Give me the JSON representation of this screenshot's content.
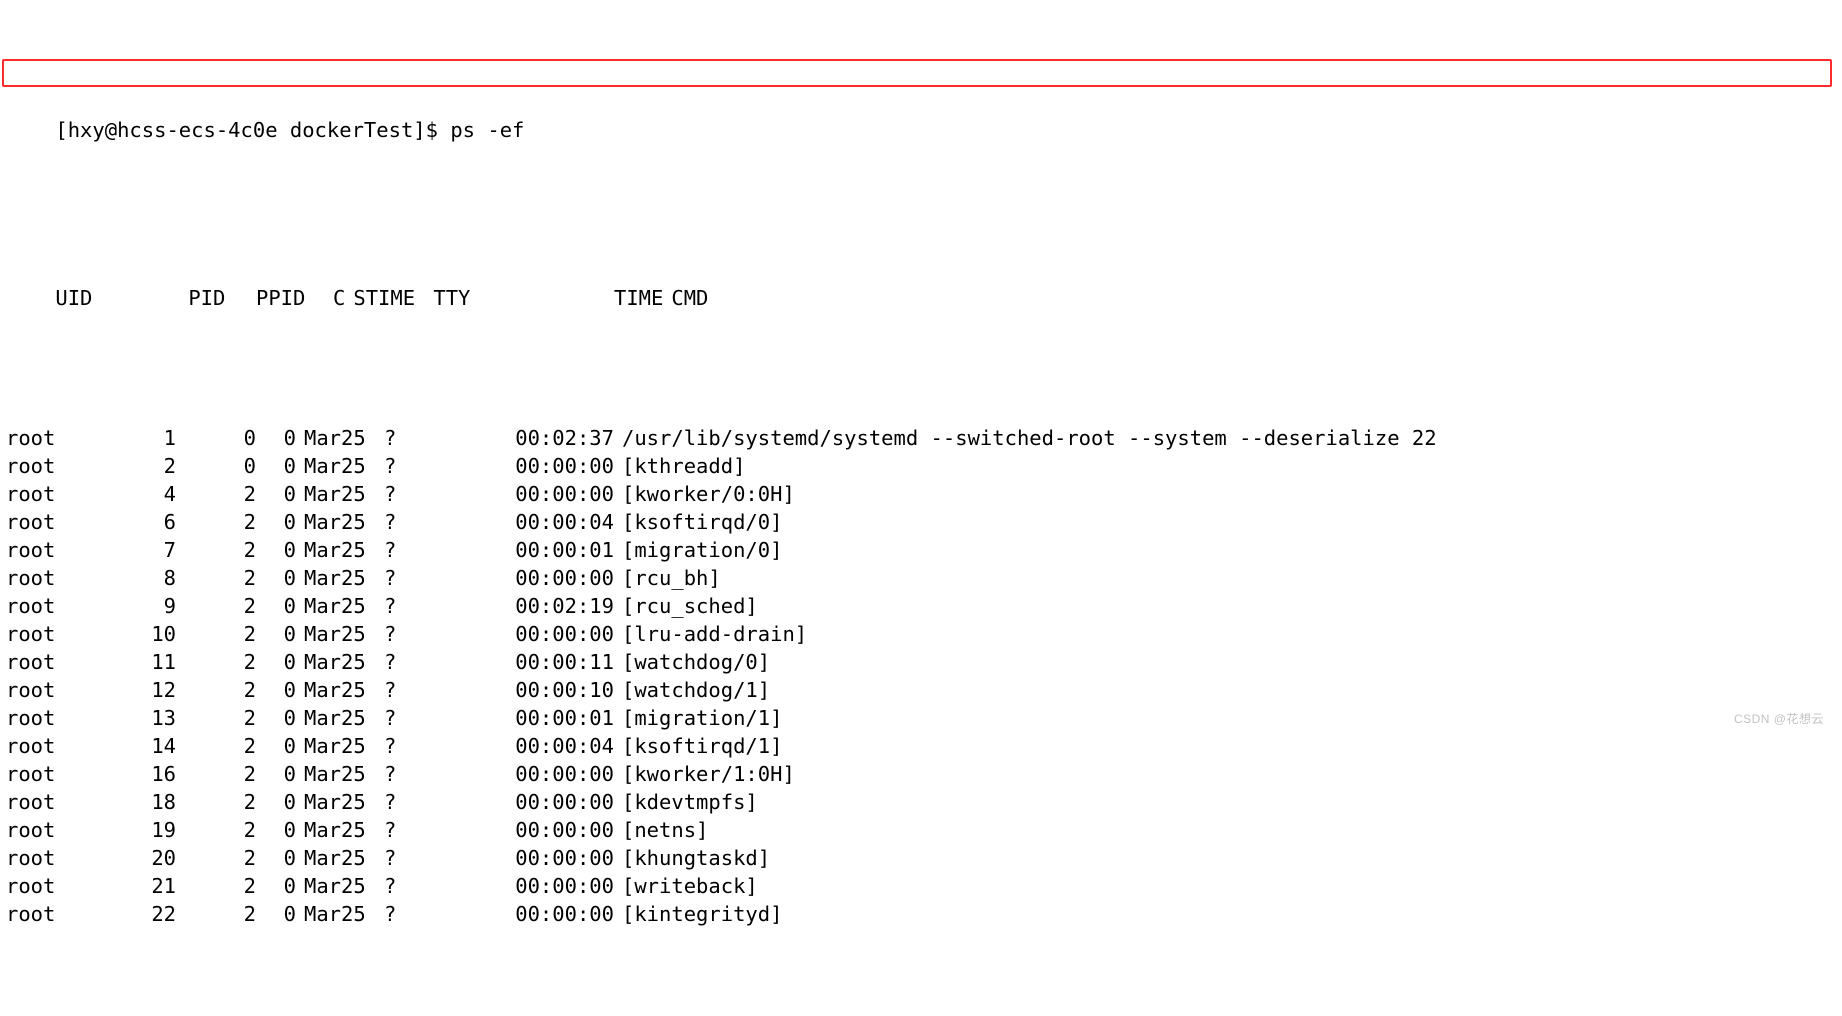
{
  "prompt_line": "[hxy@hcss-ecs-4c0e dockerTest]$ ps -ef",
  "headers": {
    "uid": "UID",
    "pid": "PID",
    "ppid": "PPID",
    "c": "C",
    "stime": "STIME",
    "tty": "TTY",
    "time": "TIME",
    "cmd": "CMD"
  },
  "rows": [
    {
      "uid": "root",
      "pid": "1",
      "ppid": "0",
      "c": "0",
      "stime": "Mar25",
      "tty": "?",
      "time": "00:02:37",
      "cmd": "/usr/lib/systemd/systemd --switched-root --system --deserialize 22",
      "hl": true
    },
    {
      "uid": "root",
      "pid": "2",
      "ppid": "0",
      "c": "0",
      "stime": "Mar25",
      "tty": "?",
      "time": "00:00:00",
      "cmd": "[kthreadd]"
    },
    {
      "uid": "root",
      "pid": "4",
      "ppid": "2",
      "c": "0",
      "stime": "Mar25",
      "tty": "?",
      "time": "00:00:00",
      "cmd": "[kworker/0:0H]"
    },
    {
      "uid": "root",
      "pid": "6",
      "ppid": "2",
      "c": "0",
      "stime": "Mar25",
      "tty": "?",
      "time": "00:00:04",
      "cmd": "[ksoftirqd/0]"
    },
    {
      "uid": "root",
      "pid": "7",
      "ppid": "2",
      "c": "0",
      "stime": "Mar25",
      "tty": "?",
      "time": "00:00:01",
      "cmd": "[migration/0]"
    },
    {
      "uid": "root",
      "pid": "8",
      "ppid": "2",
      "c": "0",
      "stime": "Mar25",
      "tty": "?",
      "time": "00:00:00",
      "cmd": "[rcu_bh]"
    },
    {
      "uid": "root",
      "pid": "9",
      "ppid": "2",
      "c": "0",
      "stime": "Mar25",
      "tty": "?",
      "time": "00:02:19",
      "cmd": "[rcu_sched]"
    },
    {
      "uid": "root",
      "pid": "10",
      "ppid": "2",
      "c": "0",
      "stime": "Mar25",
      "tty": "?",
      "time": "00:00:00",
      "cmd": "[lru-add-drain]"
    },
    {
      "uid": "root",
      "pid": "11",
      "ppid": "2",
      "c": "0",
      "stime": "Mar25",
      "tty": "?",
      "time": "00:00:11",
      "cmd": "[watchdog/0]"
    },
    {
      "uid": "root",
      "pid": "12",
      "ppid": "2",
      "c": "0",
      "stime": "Mar25",
      "tty": "?",
      "time": "00:00:10",
      "cmd": "[watchdog/1]"
    },
    {
      "uid": "root",
      "pid": "13",
      "ppid": "2",
      "c": "0",
      "stime": "Mar25",
      "tty": "?",
      "time": "00:00:01",
      "cmd": "[migration/1]"
    },
    {
      "uid": "root",
      "pid": "14",
      "ppid": "2",
      "c": "0",
      "stime": "Mar25",
      "tty": "?",
      "time": "00:00:04",
      "cmd": "[ksoftirqd/1]"
    },
    {
      "uid": "root",
      "pid": "16",
      "ppid": "2",
      "c": "0",
      "stime": "Mar25",
      "tty": "?",
      "time": "00:00:00",
      "cmd": "[kworker/1:0H]"
    },
    {
      "uid": "root",
      "pid": "18",
      "ppid": "2",
      "c": "0",
      "stime": "Mar25",
      "tty": "?",
      "time": "00:00:00",
      "cmd": "[kdevtmpfs]"
    },
    {
      "uid": "root",
      "pid": "19",
      "ppid": "2",
      "c": "0",
      "stime": "Mar25",
      "tty": "?",
      "time": "00:00:00",
      "cmd": "[netns]"
    },
    {
      "uid": "root",
      "pid": "20",
      "ppid": "2",
      "c": "0",
      "stime": "Mar25",
      "tty": "?",
      "time": "00:00:00",
      "cmd": "[khungtaskd]"
    },
    {
      "uid": "root",
      "pid": "21",
      "ppid": "2",
      "c": "0",
      "stime": "Mar25",
      "tty": "?",
      "time": "00:00:00",
      "cmd": "[writeback]"
    },
    {
      "uid": "root",
      "pid": "22",
      "ppid": "2",
      "c": "0",
      "stime": "Mar25",
      "tty": "?",
      "time": "00:00:00",
      "cmd": "[kintegrityd]"
    }
  ],
  "watermark": "CSDN @花想云"
}
